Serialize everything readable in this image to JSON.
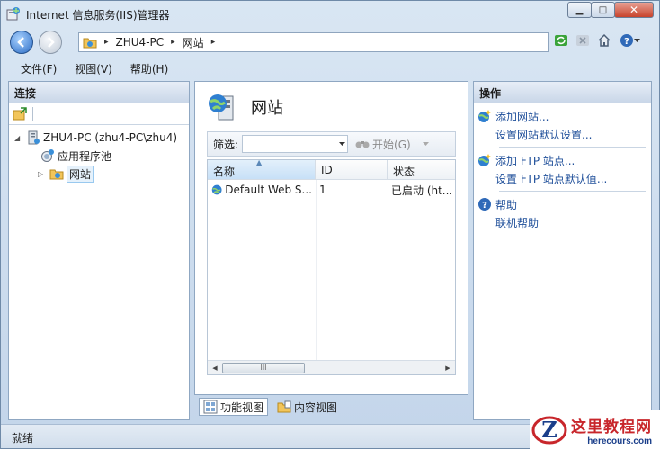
{
  "window": {
    "title": "Internet 信息服务(IIS)管理器",
    "caption": {
      "minimize": "▁",
      "maximize": "□",
      "close": "✕"
    }
  },
  "address": {
    "crumbs": [
      "ZHU4-PC",
      "网站"
    ],
    "separator": "▸"
  },
  "menu": [
    "文件(F)",
    "视图(V)",
    "帮助(H)"
  ],
  "connections": {
    "header": "连接",
    "tree": [
      {
        "label": "ZHU4-PC (zhu4-PC\\zhu4)",
        "icon": "server-icon",
        "expander": "◢"
      },
      {
        "label": "应用程序池",
        "icon": "app-pool-icon",
        "expander": ""
      },
      {
        "label": "网站",
        "icon": "sites-folder-icon",
        "expander": "▷",
        "selected": true
      }
    ]
  },
  "main": {
    "title": "网站",
    "filter": {
      "label": "筛选:",
      "value": "",
      "go_label": "开始(G)"
    },
    "grid": {
      "columns": [
        "名称",
        "ID",
        "状态"
      ],
      "rows": [
        {
          "name": "Default Web S...",
          "id": "1",
          "status": "已启动 (ht..."
        }
      ],
      "scroll_thumb": "III"
    },
    "view_tabs": [
      {
        "label": "功能视图",
        "active": true
      },
      {
        "label": "内容视图",
        "active": false
      }
    ]
  },
  "actions": {
    "header": "操作",
    "groups": [
      [
        {
          "label": "添加网站...",
          "icon": "add-site-icon"
        },
        {
          "label": "设置网站默认设置...",
          "icon": ""
        }
      ],
      [
        {
          "label": "添加 FTP 站点...",
          "icon": "add-ftp-icon"
        },
        {
          "label": "设置 FTP 站点默认值...",
          "icon": ""
        }
      ],
      [
        {
          "label": "帮助",
          "icon": "help-icon"
        },
        {
          "label": "联机帮助",
          "icon": ""
        }
      ]
    ]
  },
  "status": {
    "text": "就绪"
  },
  "watermark": {
    "cn": "这里教程网",
    "en": "herecours.com",
    "logo_letter": "Z"
  },
  "colors": {
    "link": "#1f4f9a",
    "selection": "#e5f1fb",
    "brand_red": "#c8262b"
  }
}
